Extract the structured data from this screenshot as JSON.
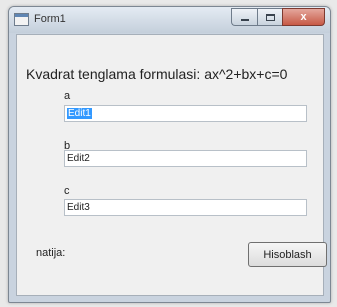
{
  "window": {
    "title": "Form1",
    "close_glyph": "x"
  },
  "form": {
    "heading": "Kvadrat tenglama formulasi: ax^2+bx+c=0",
    "fields": [
      {
        "label": "a",
        "value": "Edit1"
      },
      {
        "label": "b",
        "value": "Edit2"
      },
      {
        "label": "c",
        "value": "Edit3"
      }
    ],
    "result_label": "natija:",
    "button_label": "Hisoblash"
  }
}
